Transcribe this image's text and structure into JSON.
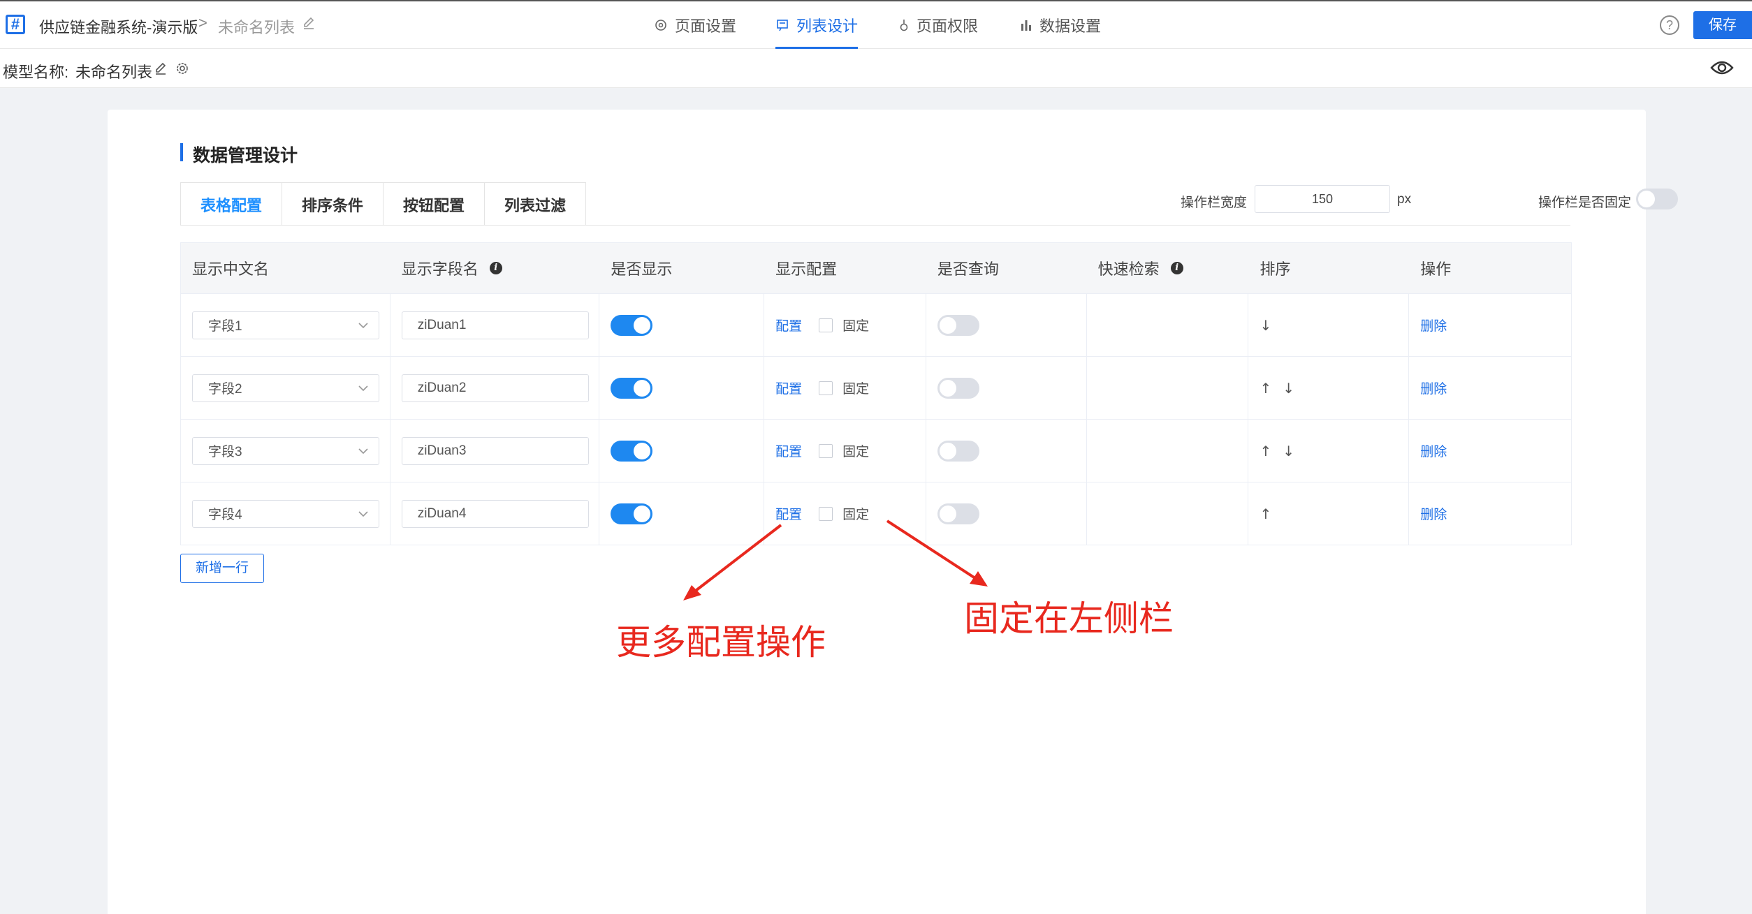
{
  "header": {
    "logo_glyph": "#",
    "app_name": "供应链金融系统-演示版",
    "breadcrumb_sep": ">",
    "page_name": "未命名列表",
    "nav": [
      {
        "label": "页面设置",
        "icon": "gear-icon"
      },
      {
        "label": "列表设计",
        "icon": "list-design-icon",
        "active": true
      },
      {
        "label": "页面权限",
        "icon": "permission-icon"
      },
      {
        "label": "数据设置",
        "icon": "bar-chart-icon"
      }
    ],
    "help_glyph": "?",
    "save_label": "保存"
  },
  "model_bar": {
    "label": "模型名称:",
    "name": "未命名列表"
  },
  "section": {
    "title": "数据管理设计",
    "tabs": [
      "表格配置",
      "排序条件",
      "按钮配置",
      "列表过滤"
    ],
    "active_tab": "表格配置"
  },
  "op_settings": {
    "width_label": "操作栏宽度",
    "width_value": "150",
    "width_unit": "px",
    "fixed_label": "操作栏是否固定",
    "fixed_on": false
  },
  "table": {
    "columns": [
      "显示中文名",
      "显示字段名",
      "是否显示",
      "显示配置",
      "是否查询",
      "快速检索",
      "排序",
      "操作"
    ],
    "rows": [
      {
        "cn_name": "字段1",
        "field": "ziDuan1",
        "show": true,
        "config": "配置",
        "fixed_label": "固定",
        "fixed": false,
        "query": false,
        "sort": [
          "↓"
        ],
        "action": "删除"
      },
      {
        "cn_name": "字段2",
        "field": "ziDuan2",
        "show": true,
        "config": "配置",
        "fixed_label": "固定",
        "fixed": false,
        "query": false,
        "sort": [
          "↑",
          "↓"
        ],
        "action": "删除"
      },
      {
        "cn_name": "字段3",
        "field": "ziDuan3",
        "show": true,
        "config": "配置",
        "fixed_label": "固定",
        "fixed": false,
        "query": false,
        "sort": [
          "↑",
          "↓"
        ],
        "action": "删除"
      },
      {
        "cn_name": "字段4",
        "field": "ziDuan4",
        "show": true,
        "config": "配置",
        "fixed_label": "固定",
        "fixed": false,
        "query": false,
        "sort": [
          "↑"
        ],
        "action": "删除"
      }
    ],
    "add_row_label": "新增一行"
  },
  "annotations": {
    "more_config": "更多配置操作",
    "fix_left": "固定在左侧栏",
    "color": "#e8281e"
  },
  "colors": {
    "accent": "#1e6fe6",
    "switch_on": "#1e88f0",
    "annotation": "#e8281e"
  }
}
